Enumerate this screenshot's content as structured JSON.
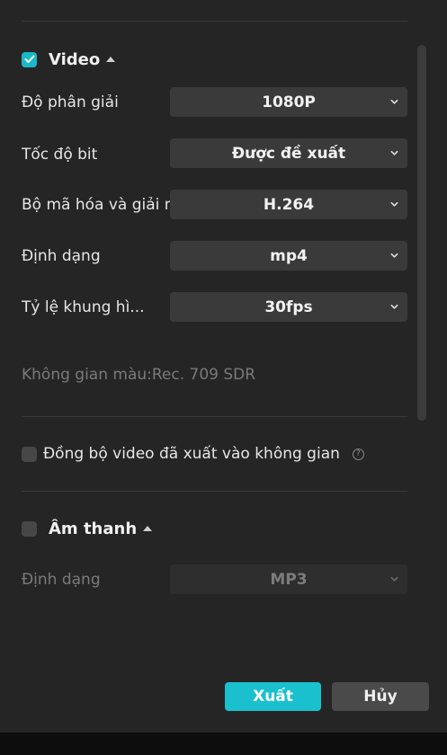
{
  "video": {
    "title": "Video",
    "checked": true,
    "rows": [
      {
        "label": "Độ phân giải",
        "value": "1080P"
      },
      {
        "label": "Tốc độ bit",
        "value": "Được đề xuất"
      },
      {
        "label": "Bộ mã hóa và giải m",
        "value": "H.264"
      },
      {
        "label": "Định dạng",
        "value": "mp4"
      },
      {
        "label": "Tỷ lệ khung hì...",
        "value": "30fps"
      }
    ],
    "color_space": "Không gian màu:Rec. 709 SDR"
  },
  "sync": {
    "label": "Đồng bộ video đã xuất vào không gian",
    "checked": false,
    "help_icon": "question-circle-icon"
  },
  "audio": {
    "title": "Âm thanh",
    "checked": false,
    "rows": [
      {
        "label": "Định dạng",
        "value": "MP3"
      }
    ]
  },
  "buttons": {
    "export": "Xuất",
    "cancel": "Hủy"
  },
  "colors": {
    "accent": "#1bc0cf",
    "panel": "#252525",
    "select": "#3a3a3a"
  }
}
